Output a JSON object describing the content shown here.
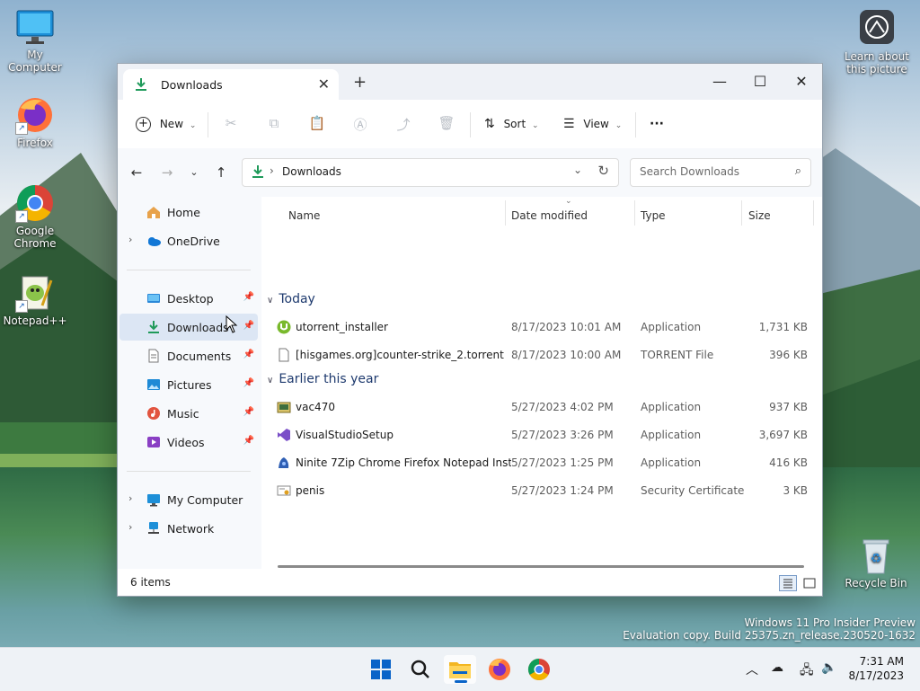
{
  "desktop": {
    "icons": [
      {
        "label": "My Computer"
      },
      {
        "label": "Firefox"
      },
      {
        "label": "Google Chrome"
      },
      {
        "label": "Notepad++"
      },
      {
        "label": "Learn about this picture"
      },
      {
        "label": "Recycle Bin"
      }
    ],
    "watermark": {
      "line1": "Windows 11 Pro Insider Preview",
      "line2": "Evaluation copy. Build 25375.zn_release.230520-1632"
    }
  },
  "window": {
    "tab_title": "Downloads",
    "tab_close": "✕",
    "new_tab": "+",
    "controls": {
      "minimize": "—",
      "maximize": "☐",
      "close": "✕"
    },
    "toolbar": {
      "new_label": "New",
      "sort_label": "Sort",
      "view_label": "View",
      "more_label": "···"
    },
    "address": {
      "path": "Downloads",
      "separator": "›"
    },
    "search": {
      "placeholder": "Search Downloads"
    },
    "nav": {
      "top": [
        {
          "label": "Home"
        },
        {
          "label": "OneDrive"
        }
      ],
      "quick": [
        {
          "label": "Desktop"
        },
        {
          "label": "Downloads"
        },
        {
          "label": "Documents"
        },
        {
          "label": "Pictures"
        },
        {
          "label": "Music"
        },
        {
          "label": "Videos"
        }
      ],
      "bottom": [
        {
          "label": "My Computer"
        },
        {
          "label": "Network"
        }
      ]
    },
    "columns": {
      "name": "Name",
      "date": "Date modified",
      "type": "Type",
      "size": "Size"
    },
    "groups": [
      {
        "title": "Today",
        "files": [
          {
            "name": "utorrent_installer",
            "date": "8/17/2023 10:01 AM",
            "type": "Application",
            "size": "1,731 KB",
            "icon": "utorrent-icon"
          },
          {
            "name": "[hisgames.org]counter-strike_2.torrent",
            "date": "8/17/2023 10:00 AM",
            "type": "TORRENT File",
            "size": "396 KB",
            "icon": "torrent-file-icon"
          }
        ]
      },
      {
        "title": "Earlier this year",
        "files": [
          {
            "name": "vac470",
            "date": "5/27/2023 4:02 PM",
            "type": "Application",
            "size": "937 KB",
            "icon": "installer-icon"
          },
          {
            "name": "VisualStudioSetup",
            "date": "5/27/2023 3:26 PM",
            "type": "Application",
            "size": "3,697 KB",
            "icon": "visual-studio-icon"
          },
          {
            "name": "Ninite 7Zip Chrome Firefox Notepad Inst...",
            "date": "5/27/2023 1:25 PM",
            "type": "Application",
            "size": "416 KB",
            "icon": "ninite-icon"
          },
          {
            "name": "penis",
            "date": "5/27/2023 1:24 PM",
            "type": "Security Certificate",
            "size": "3 KB",
            "icon": "certificate-icon"
          }
        ]
      }
    ],
    "status": "6 items"
  },
  "taskbar": {
    "time": "7:31 AM",
    "date": "8/17/2023",
    "apps": [
      "start-icon",
      "search-icon",
      "file-explorer-icon",
      "firefox-icon",
      "chrome-icon"
    ]
  },
  "colors": {
    "accent": "#0a64c8",
    "selection": "#dce6f4",
    "group_header": "#1e3a6e"
  }
}
